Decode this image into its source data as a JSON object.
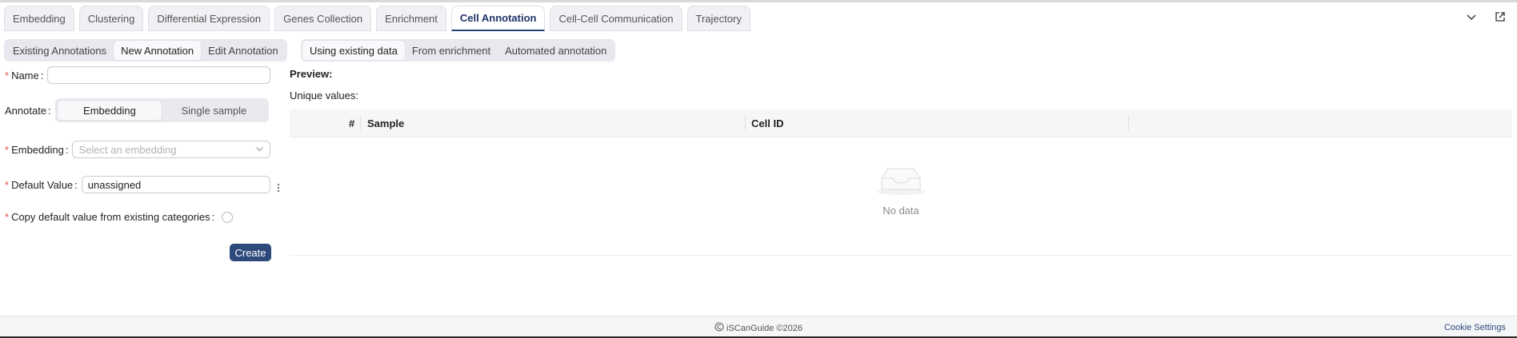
{
  "top_tabs": [
    {
      "label": "Embedding"
    },
    {
      "label": "Clustering"
    },
    {
      "label": "Differential Expression"
    },
    {
      "label": "Genes Collection"
    },
    {
      "label": "Enrichment"
    },
    {
      "label": "Cell Annotation",
      "active": true
    },
    {
      "label": "Cell-Cell Communication"
    },
    {
      "label": "Trajectory"
    }
  ],
  "top_icons": [
    "chevron-down-icon",
    "open-external-icon"
  ],
  "annotation_tabs": [
    {
      "label": "Existing Annotations"
    },
    {
      "label": "New Annotation",
      "active": true
    },
    {
      "label": "Edit Annotation"
    }
  ],
  "source_tabs": [
    {
      "label": "Using existing data",
      "active": true
    },
    {
      "label": "From enrichment"
    },
    {
      "label": "Automated annotation"
    }
  ],
  "form": {
    "name_label": "Name",
    "name_value": "",
    "annotate_label": "Annotate",
    "annotate_options": [
      "Embedding",
      "Single sample"
    ],
    "annotate_selected": "Embedding",
    "embedding_label": "Embedding",
    "embedding_placeholder": "Select an embedding",
    "default_value_label": "Default Value",
    "default_value": "unassigned",
    "copy_default_label": "Copy default value from existing categories",
    "create_label": "Create"
  },
  "preview": {
    "title": "Preview:",
    "unique_label": "Unique values:",
    "columns": [
      "#",
      "Sample",
      "Cell ID"
    ],
    "empty_text": "No data"
  },
  "footer": {
    "brand": "iSCanGuide ©2026",
    "cookie_settings": "Cookie Settings"
  },
  "colors": {
    "accent": "#2d4a7b",
    "required": "#e04f44"
  }
}
